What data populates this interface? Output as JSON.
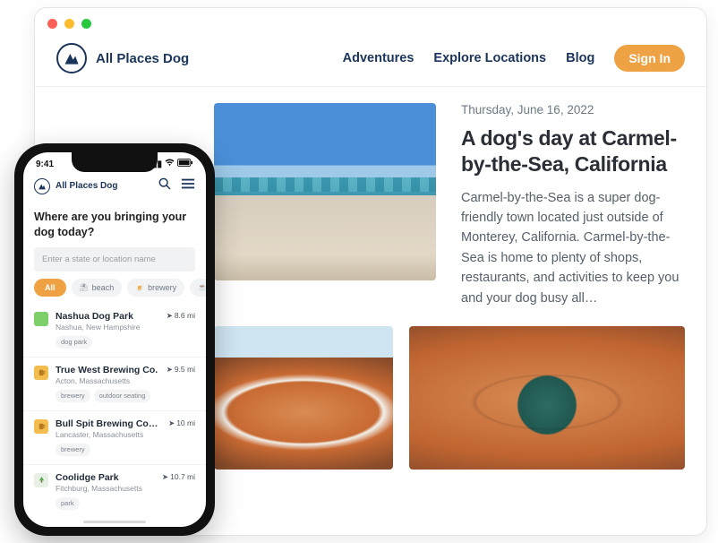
{
  "desktop": {
    "brand": "All Places Dog",
    "nav": {
      "adventures": "Adventures",
      "explore": "Explore Locations",
      "blog": "Blog",
      "signin": "Sign In"
    },
    "article": {
      "date": "Thursday, June 16, 2022",
      "title": "A dog's day at Carmel-by-the-Sea, California",
      "body": "Carmel-by-the-Sea is a super dog-friendly town located just outside of Monterey, California. Carmel-by-the-Sea is home to plenty of shops, restaurants, and activities to keep you and your dog busy all…"
    }
  },
  "mobile": {
    "time": "9:41",
    "brand": "All Places Dog",
    "prompt": "Where are you bringing your dog today?",
    "search_placeholder": "Enter a state or location name",
    "chips": {
      "all": "All",
      "beach": "beach",
      "brewery": "brewery",
      "cafe": "cafe"
    },
    "items": [
      {
        "name": "Nashua Dog Park",
        "loc": "Nashua, New Hampshire",
        "dist": "8.6 mi",
        "tags": [
          "dog park"
        ]
      },
      {
        "name": "True West Brewing Co.",
        "loc": "Acton, Massachusetts",
        "dist": "9.5 mi",
        "tags": [
          "brewery",
          "outdoor seating"
        ]
      },
      {
        "name": "Bull Spit Brewing Company",
        "loc": "Lancaster, Massachusetts",
        "dist": "10 mi",
        "tags": [
          "brewery"
        ]
      },
      {
        "name": "Coolidge Park",
        "loc": "Fitchburg, Massachusetts",
        "dist": "10.7 mi",
        "tags": [
          "park"
        ]
      }
    ]
  }
}
